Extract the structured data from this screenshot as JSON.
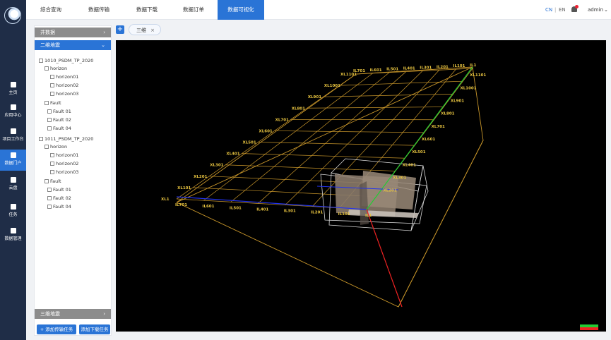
{
  "top_tabs": [
    {
      "label": "综合查询"
    },
    {
      "label": "数据传输"
    },
    {
      "label": "数据下载"
    },
    {
      "label": "数据订单"
    },
    {
      "label": "数据可视化"
    }
  ],
  "lang": {
    "cn": "CN",
    "sep": "|",
    "en": "EN"
  },
  "user": {
    "name": "admin",
    "caret": "⌄"
  },
  "rail": [
    {
      "label": "主页"
    },
    {
      "label": "应用中心"
    },
    {
      "label": "项目工作台"
    },
    {
      "label": "数据门户"
    },
    {
      "label": "云盘"
    },
    {
      "label": "任务"
    },
    {
      "label": "数据管理"
    }
  ],
  "side": {
    "well_data": "井数据",
    "seismic_2d": "二维地震",
    "seismic_3d": "三维地震",
    "arrow_right": "›",
    "arrow_down": "⌄",
    "add_transfer": "+ 添加传输任务",
    "add_download": "添加下载任务",
    "tree": [
      {
        "text": "1010_PSDM_TP_2020"
      },
      {
        "text": "horizon"
      },
      {
        "text": "horizon01"
      },
      {
        "text": "horizon02"
      },
      {
        "text": "horizon03"
      },
      {
        "text": "Fault"
      },
      {
        "text": "Fault 01"
      },
      {
        "text": "Fault 02"
      },
      {
        "text": "Fault 04"
      },
      {
        "text": "1011_PSDM_TP_2020"
      },
      {
        "text": "horizon"
      },
      {
        "text": "horizon01"
      },
      {
        "text": "horizon02"
      },
      {
        "text": "horizon03"
      },
      {
        "text": "Fault"
      },
      {
        "text": "Fault 01"
      },
      {
        "text": "Fault 02"
      },
      {
        "text": "Fault 04"
      }
    ]
  },
  "viewer": {
    "add": "+",
    "tab_label": "三维",
    "tab_close": "×",
    "labels": {
      "il_top": [
        "IL1",
        "IL101",
        "IL201",
        "IL301",
        "IL401",
        "IL501",
        "IL601",
        "IL701"
      ],
      "xl_right": [
        "XL1101",
        "XL1001",
        "XL901",
        "XL801",
        "XL701",
        "XL601",
        "XL501",
        "XL401",
        "XL301",
        "XL201"
      ],
      "xl_left": [
        "XL1101",
        "XL1001",
        "XL901",
        "XL801",
        "XL701",
        "XL601",
        "XL501",
        "XL401",
        "XL301",
        "XL201",
        "XL101",
        "XL1"
      ],
      "il_bottom": [
        "IL701",
        "IL601",
        "IL501",
        "IL401",
        "IL301",
        "IL201",
        "IL101",
        "IL1"
      ]
    }
  },
  "colors": {
    "accent": "#2a74d6",
    "rail": "#1f2d47",
    "grid": "#c8962a",
    "label": "#e8c440"
  }
}
